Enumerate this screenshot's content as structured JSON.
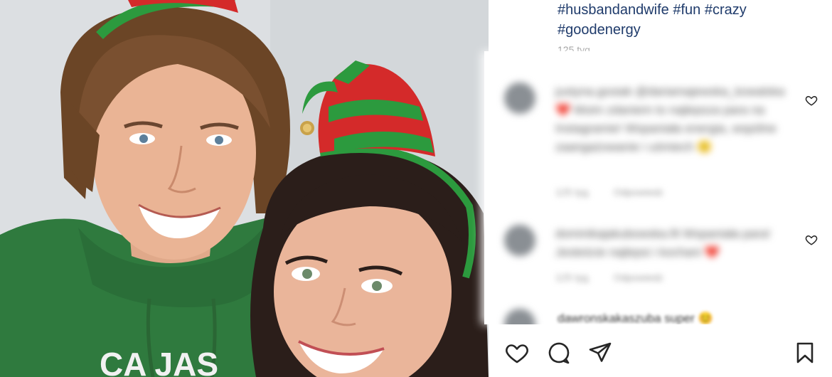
{
  "post": {
    "caption_line1": "#husbandandwife #fun #crazy",
    "caption_line2": "#goodenergy",
    "time": "125 tyg."
  },
  "comments": [
    {
      "text": "justyna.gosiak @dariamajewska_kowalska ❤️ Moim zdaniem to najlepsza para na Instagramie! Wspaniała energia, wspólne zaangażowanie i uśmiech 🙂",
      "time": "125 tyg.",
      "reply_label": "Odpowiedz"
    },
    {
      "text": "dominikajakubowska.fit Wspaniała para! Jesteście najlepsi i kochani ❤️",
      "time": "125 tyg.",
      "reply_label": "Odpowiedz"
    }
  ],
  "partial_comment": "dawronskakaszuba super 😊",
  "actions": {
    "like": "heart-icon",
    "comment": "comment-icon",
    "share": "share-icon",
    "save": "bookmark-icon"
  },
  "colors": {
    "hoodie": "#2e7d3f",
    "elf_red": "#d42a2a",
    "elf_green": "#2c9a3e",
    "hashtag": "#1c3c66"
  }
}
